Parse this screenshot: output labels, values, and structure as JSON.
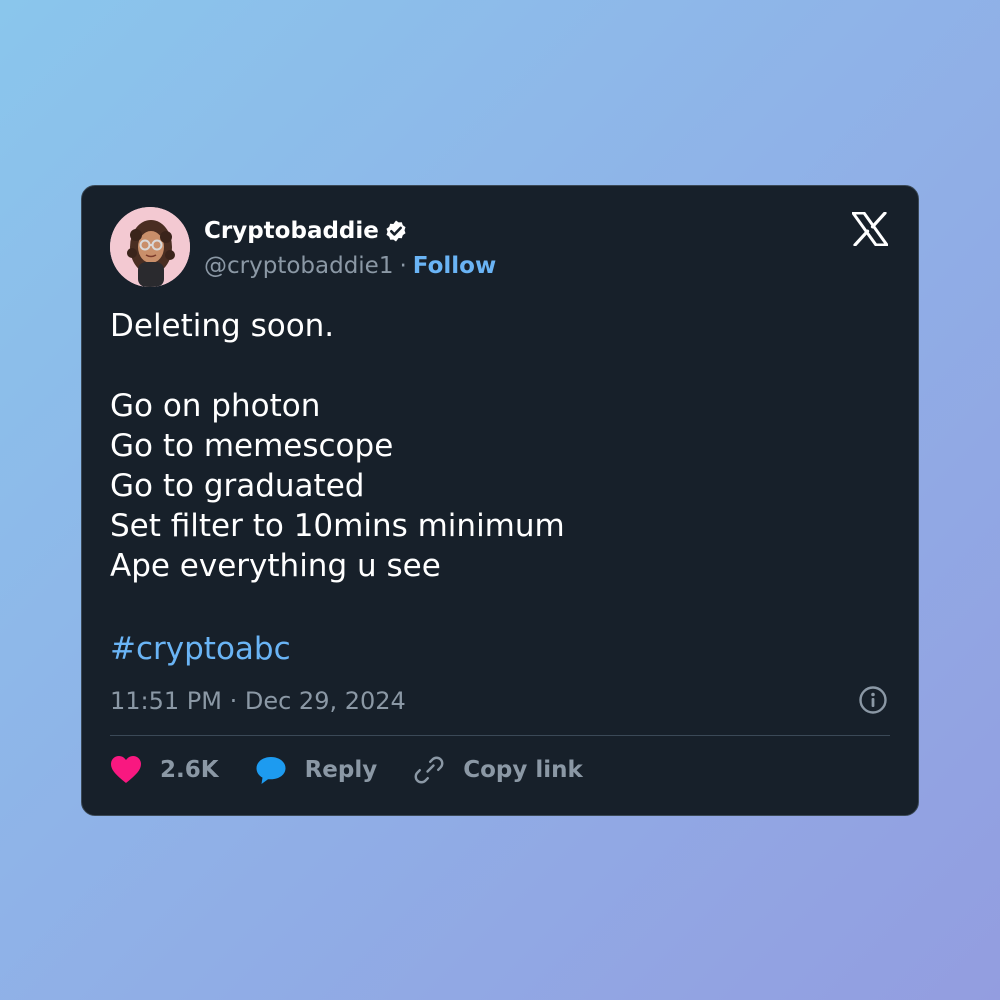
{
  "author": {
    "display_name": "Cryptobaddie",
    "handle": "@cryptobaddie1",
    "separator": "·",
    "follow_label": "Follow",
    "verified": true
  },
  "tweet": {
    "lines": [
      "Deleting soon.",
      "",
      "Go on photon",
      "Go to memescope",
      "Go to graduated",
      "Set filter to 10mins minimum",
      "Ape everything u see"
    ],
    "hashtag": "#cryptoabc",
    "timestamp": "11:51 PM · Dec 29, 2024"
  },
  "actions": {
    "like_count": "2.6K",
    "reply_label": "Reply",
    "copy_link_label": "Copy link"
  },
  "icons": {
    "brand": "x-logo-icon",
    "verified": "verified-badge-icon",
    "info": "info-icon",
    "like": "heart-icon",
    "reply": "speech-bubble-icon",
    "copy": "link-icon"
  },
  "colors": {
    "card_background": "#17202a",
    "accent_blue": "#6ab4f5",
    "muted_text": "#8b98a5",
    "heart": "#f91880",
    "reply_bubble": "#1d9bf0"
  }
}
